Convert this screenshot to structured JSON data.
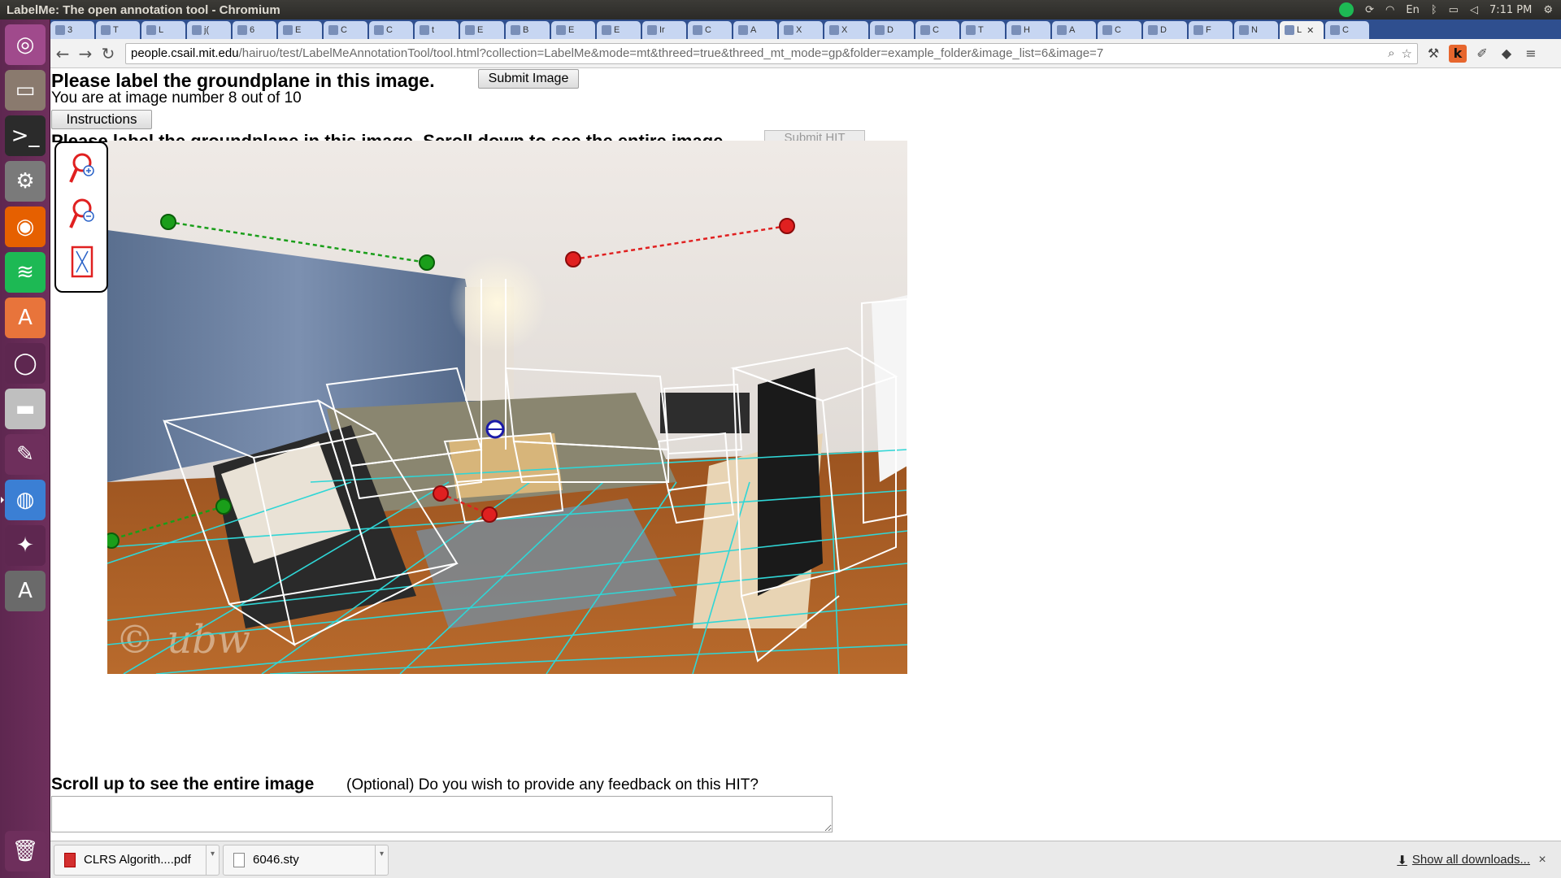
{
  "window": {
    "title": "LabelMe: The open annotation tool - Chromium"
  },
  "system": {
    "clock": "7:11 PM",
    "keyboard": "En"
  },
  "launcher": {
    "items": [
      {
        "name": "ubuntu-dash-icon",
        "color": "#a04a8c",
        "glyph": "◎"
      },
      {
        "name": "files-icon",
        "color": "#8a7a6e",
        "glyph": "▭"
      },
      {
        "name": "terminal-icon",
        "color": "#2b2b2b",
        "glyph": ">_"
      },
      {
        "name": "system-settings-icon",
        "color": "#7a7a7a",
        "glyph": "⚙"
      },
      {
        "name": "firefox-icon",
        "color": "#e66000",
        "glyph": "◉"
      },
      {
        "name": "spotify-icon",
        "color": "#1db954",
        "glyph": "≋"
      },
      {
        "name": "software-center-icon",
        "color": "#e8743b",
        "glyph": "A"
      },
      {
        "name": "app-ring-icon",
        "color": "#5e2750",
        "glyph": "◯"
      },
      {
        "name": "drive-icon",
        "color": "#bfbfbf",
        "glyph": "▬"
      },
      {
        "name": "paint-icon",
        "color": "#6e2f5c",
        "glyph": "✎"
      },
      {
        "name": "chromium-icon",
        "color": "#3b7fd4",
        "glyph": "◍"
      },
      {
        "name": "shutter-icon",
        "color": "#5e2750",
        "glyph": "✦"
      },
      {
        "name": "updater-icon",
        "color": "#6a6a6a",
        "glyph": "A"
      },
      {
        "name": "trash-icon",
        "color": "#6e2f5c",
        "glyph": "🗑"
      }
    ]
  },
  "tabs": [
    {
      "label": "3"
    },
    {
      "label": "T"
    },
    {
      "label": "L"
    },
    {
      "label": "j("
    },
    {
      "label": "6"
    },
    {
      "label": "E"
    },
    {
      "label": "C"
    },
    {
      "label": "C"
    },
    {
      "label": "t"
    },
    {
      "label": "E"
    },
    {
      "label": "B"
    },
    {
      "label": "E"
    },
    {
      "label": "E"
    },
    {
      "label": "Ir"
    },
    {
      "label": "C"
    },
    {
      "label": "A"
    },
    {
      "label": "X"
    },
    {
      "label": "X"
    },
    {
      "label": "D"
    },
    {
      "label": "C"
    },
    {
      "label": "T"
    },
    {
      "label": "H"
    },
    {
      "label": "A"
    },
    {
      "label": "C"
    },
    {
      "label": "D"
    },
    {
      "label": "F"
    },
    {
      "label": "N"
    },
    {
      "label": "L",
      "active": true
    },
    {
      "label": "C"
    }
  ],
  "url": {
    "host": "people.csail.mit.edu",
    "path": "/hairuo/test/LabelMeAnnotationTool/tool.html?collection=LabelMe&mode=mt&threed=true&threed_mt_mode=gp&folder=example_folder&image_list=6&image=7"
  },
  "page": {
    "instruction_title": "Please label the groundplane in this image.",
    "submit_image_label": "Submit Image",
    "progress_text": "You are at image number 8 out of 10",
    "instructions_label": "Instructions",
    "hidden_title": "Please label the groundplane in this image. Scroll down to see the entire image.",
    "hidden_submit": "Submit HIT",
    "watermark": "© ubw",
    "feedback_title": "Scroll up to see the entire image",
    "feedback_question": "(Optional) Do you wish to provide any feedback on this HIT?",
    "feedback_value": ""
  },
  "tools": [
    {
      "name": "zoom-in-icon"
    },
    {
      "name": "zoom-out-icon"
    },
    {
      "name": "fit-image-icon"
    }
  ],
  "downloads": {
    "items": [
      {
        "filename": "CLRS Algorith....pdf",
        "type": "pdf"
      },
      {
        "filename": "6046.sty",
        "type": "sty"
      }
    ],
    "show_all": "Show all downloads..."
  },
  "colors": {
    "launcher_bg": "#5e2750",
    "tabstrip_bg": "#2f4f8f",
    "ground_grid": "#2fd6d6",
    "green_line": "#1a9e1a",
    "red_line": "#e02020",
    "box_outline": "#ffffff"
  }
}
